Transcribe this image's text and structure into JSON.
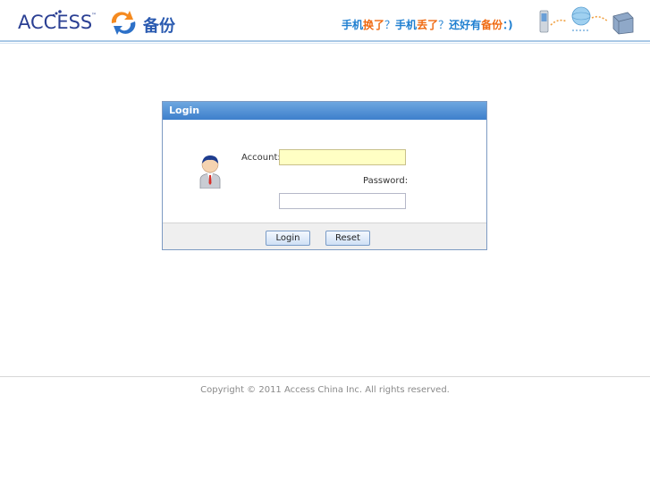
{
  "header": {
    "brand": "ACCESS",
    "brand_tm": "™",
    "backup_label": "备份",
    "slogan_parts": [
      "手机",
      "换了",
      "？",
      "手机",
      "丢了",
      "？",
      "还好有",
      "备份",
      "：)"
    ]
  },
  "login": {
    "title": "Login",
    "account_label": "Account:",
    "account_value": "",
    "password_label": "Password:",
    "password_value": "",
    "login_button": "Login",
    "reset_button": "Reset"
  },
  "footer": {
    "copyright": "Copyright © 2011 Access China Inc. All rights reserved."
  },
  "colors": {
    "brand_blue": "#2a3f93",
    "slogan_blue": "#1f7fd0",
    "slogan_orange": "#ef6a12",
    "panel_header": "#3d7fcc",
    "account_field_bg": "#ffffc4"
  },
  "icons": [
    "access-logo-dots-icon",
    "backup-sync-icon",
    "phone-to-cloud-to-box-icon",
    "user-avatar-icon"
  ]
}
